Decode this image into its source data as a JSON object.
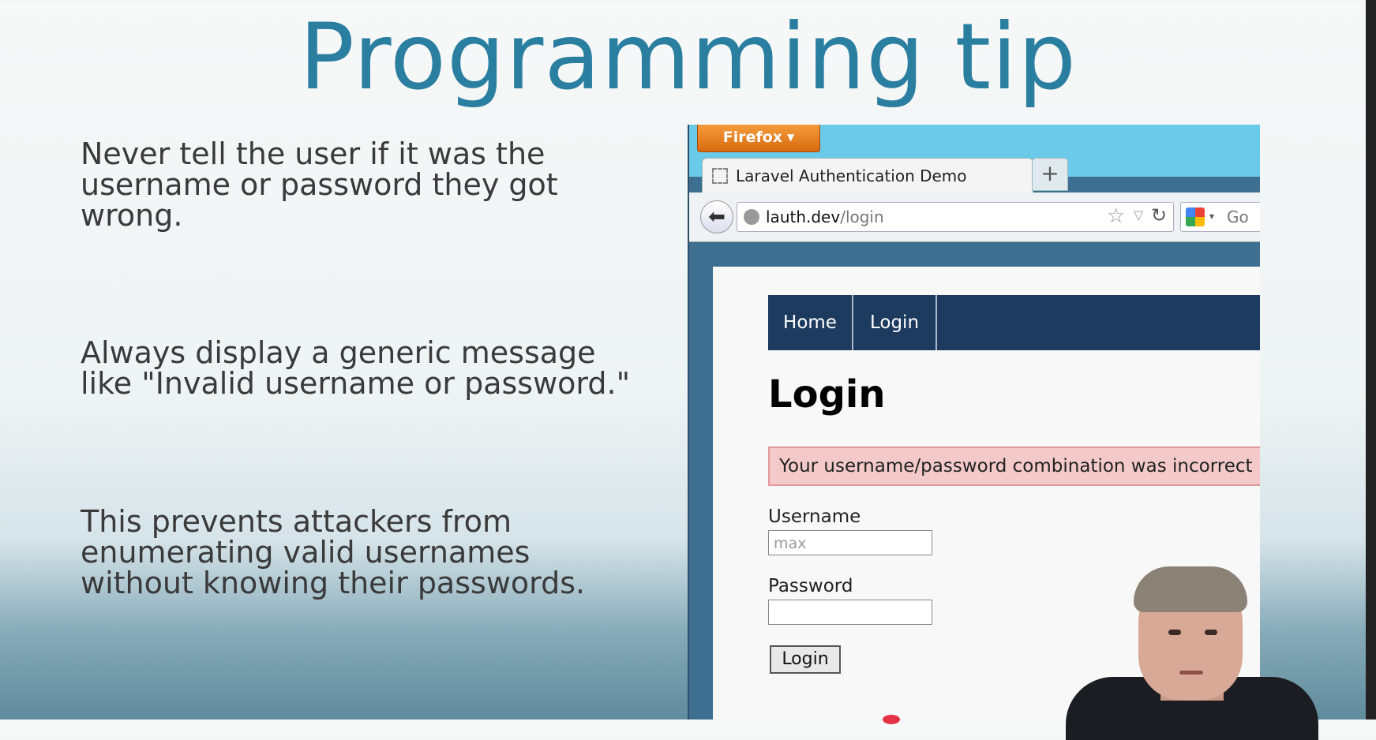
{
  "slide": {
    "title": "Programming tip",
    "paragraphs": [
      {
        "lines": [
          "Never tell the user if it was the",
          "username or password they got",
          "wrong."
        ]
      },
      {
        "lines": [
          "Always display a generic message",
          "like \"Invalid username or password.\""
        ]
      },
      {
        "lines": [
          "This prevents attackers from",
          "enumerating valid usernames",
          "without knowing their passwords."
        ]
      }
    ]
  },
  "browser": {
    "menu_button": "Firefox",
    "tab_title": "Laravel Authentication Demo",
    "new_tab": "+",
    "url_host": "lauth.dev",
    "url_path": "/login",
    "search_text": "Go"
  },
  "page": {
    "nav": [
      "Home",
      "Login"
    ],
    "heading": "Login",
    "error": "Your username/password combination was incorrect",
    "username_label": "Username",
    "username_value": "max",
    "password_label": "Password",
    "password_value": "",
    "submit": "Login"
  },
  "colors": {
    "title": "#2a7ea0",
    "nav_bg": "#1d3a5f",
    "alert_bg": "#f3c9c9",
    "firefox_orange": "#e8801f"
  }
}
